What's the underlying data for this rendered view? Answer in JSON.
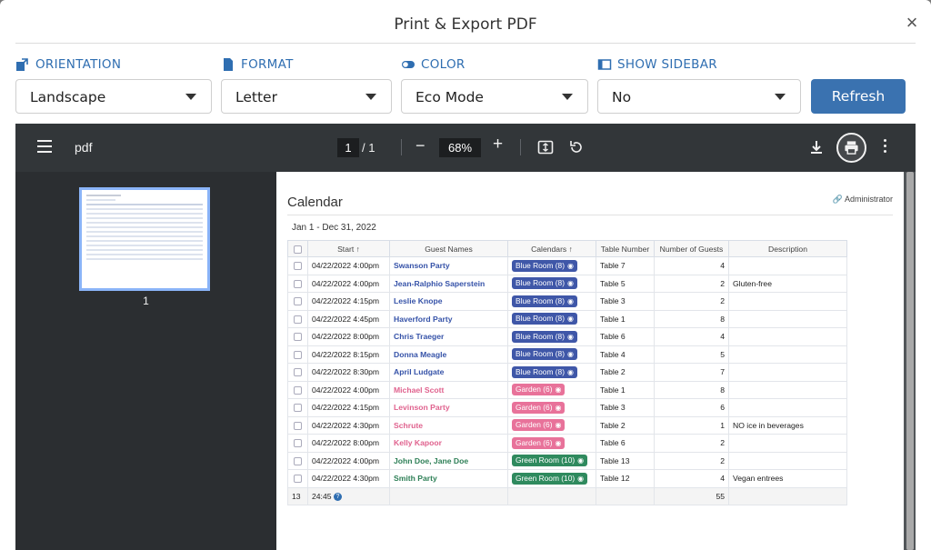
{
  "dialog": {
    "title": "Print & Export PDF",
    "close_glyph": "×"
  },
  "options": {
    "orientation": {
      "label": "ORIENTATION",
      "value": "Landscape",
      "icon": "orientation-icon"
    },
    "format": {
      "label": "FORMAT",
      "value": "Letter",
      "icon": "document-icon"
    },
    "color": {
      "label": "COLOR",
      "value": "Eco Mode",
      "icon": "toggle-icon"
    },
    "sidebar": {
      "label": "SHOW SIDEBAR",
      "value": "No",
      "icon": "sidebar-icon"
    },
    "refresh_label": "Refresh",
    "accent": "#2f6eb1"
  },
  "viewer": {
    "title": "pdf",
    "page": "1",
    "total": "/ 1",
    "zoom": "68%",
    "minus": "−",
    "plus": "+",
    "thumb_page": "1"
  },
  "calendar": {
    "title": "Calendar",
    "admin": "Administrator",
    "range": "Jan 1 - Dec 31, 2022",
    "columns": [
      "Start ↑",
      "Guest Names",
      "Calendars ↑",
      "Table Number",
      "Number of Guests",
      "Description"
    ],
    "rows": [
      {
        "start": "04/22/2022 4:00pm",
        "guest": "Swanson Party",
        "calendar": "Blue Room (8)",
        "cal_color": "#3f57a8",
        "guest_color": "#3552a8",
        "table": "Table 7",
        "guests": "4",
        "desc": ""
      },
      {
        "start": "04/22/2022 4:00pm",
        "guest": "Jean-Ralphio Saperstein",
        "calendar": "Blue Room (8)",
        "cal_color": "#3f57a8",
        "guest_color": "#3552a8",
        "table": "Table 5",
        "guests": "2",
        "desc": "Gluten-free"
      },
      {
        "start": "04/22/2022 4:15pm",
        "guest": "Leslie Knope",
        "calendar": "Blue Room (8)",
        "cal_color": "#3f57a8",
        "guest_color": "#3552a8",
        "table": "Table 3",
        "guests": "2",
        "desc": ""
      },
      {
        "start": "04/22/2022 4:45pm",
        "guest": "Haverford Party",
        "calendar": "Blue Room (8)",
        "cal_color": "#3f57a8",
        "guest_color": "#3552a8",
        "table": "Table 1",
        "guests": "8",
        "desc": ""
      },
      {
        "start": "04/22/2022 8:00pm",
        "guest": "Chris Traeger",
        "calendar": "Blue Room (8)",
        "cal_color": "#3f57a8",
        "guest_color": "#3552a8",
        "table": "Table 6",
        "guests": "4",
        "desc": ""
      },
      {
        "start": "04/22/2022 8:15pm",
        "guest": "Donna Meagle",
        "calendar": "Blue Room (8)",
        "cal_color": "#3f57a8",
        "guest_color": "#3552a8",
        "table": "Table 4",
        "guests": "5",
        "desc": ""
      },
      {
        "start": "04/22/2022 8:30pm",
        "guest": "April Ludgate",
        "calendar": "Blue Room (8)",
        "cal_color": "#3f57a8",
        "guest_color": "#3552a8",
        "table": "Table 2",
        "guests": "7",
        "desc": ""
      },
      {
        "start": "04/22/2022 4:00pm",
        "guest": "Michael Scott",
        "calendar": "Garden (6)",
        "cal_color": "#e8729a",
        "guest_color": "#e0628e",
        "table": "Table 1",
        "guests": "8",
        "desc": ""
      },
      {
        "start": "04/22/2022 4:15pm",
        "guest": "Levinson Party",
        "calendar": "Garden (6)",
        "cal_color": "#e8729a",
        "guest_color": "#e0628e",
        "table": "Table 3",
        "guests": "6",
        "desc": ""
      },
      {
        "start": "04/22/2022 4:30pm",
        "guest": "Schrute",
        "calendar": "Garden (6)",
        "cal_color": "#e8729a",
        "guest_color": "#e0628e",
        "table": "Table 2",
        "guests": "1",
        "desc": "NO ice in beverages"
      },
      {
        "start": "04/22/2022 8:00pm",
        "guest": "Kelly Kapoor",
        "calendar": "Garden (6)",
        "cal_color": "#e8729a",
        "guest_color": "#e0628e",
        "table": "Table 6",
        "guests": "2",
        "desc": ""
      },
      {
        "start": "04/22/2022 4:00pm",
        "guest": "John Doe, Jane Doe",
        "calendar": "Green Room (10)",
        "cal_color": "#2f8a5e",
        "guest_color": "#2d7f56",
        "table": "Table 13",
        "guests": "2",
        "desc": ""
      },
      {
        "start": "04/22/2022 4:30pm",
        "guest": "Smith Party",
        "calendar": "Green Room (10)",
        "cal_color": "#2f8a5e",
        "guest_color": "#2d7f56",
        "table": "Table 12",
        "guests": "4",
        "desc": "Vegan entrees"
      }
    ],
    "footer": {
      "count": "13",
      "duration": "24:45",
      "help": "?",
      "total_guests": "55"
    }
  }
}
